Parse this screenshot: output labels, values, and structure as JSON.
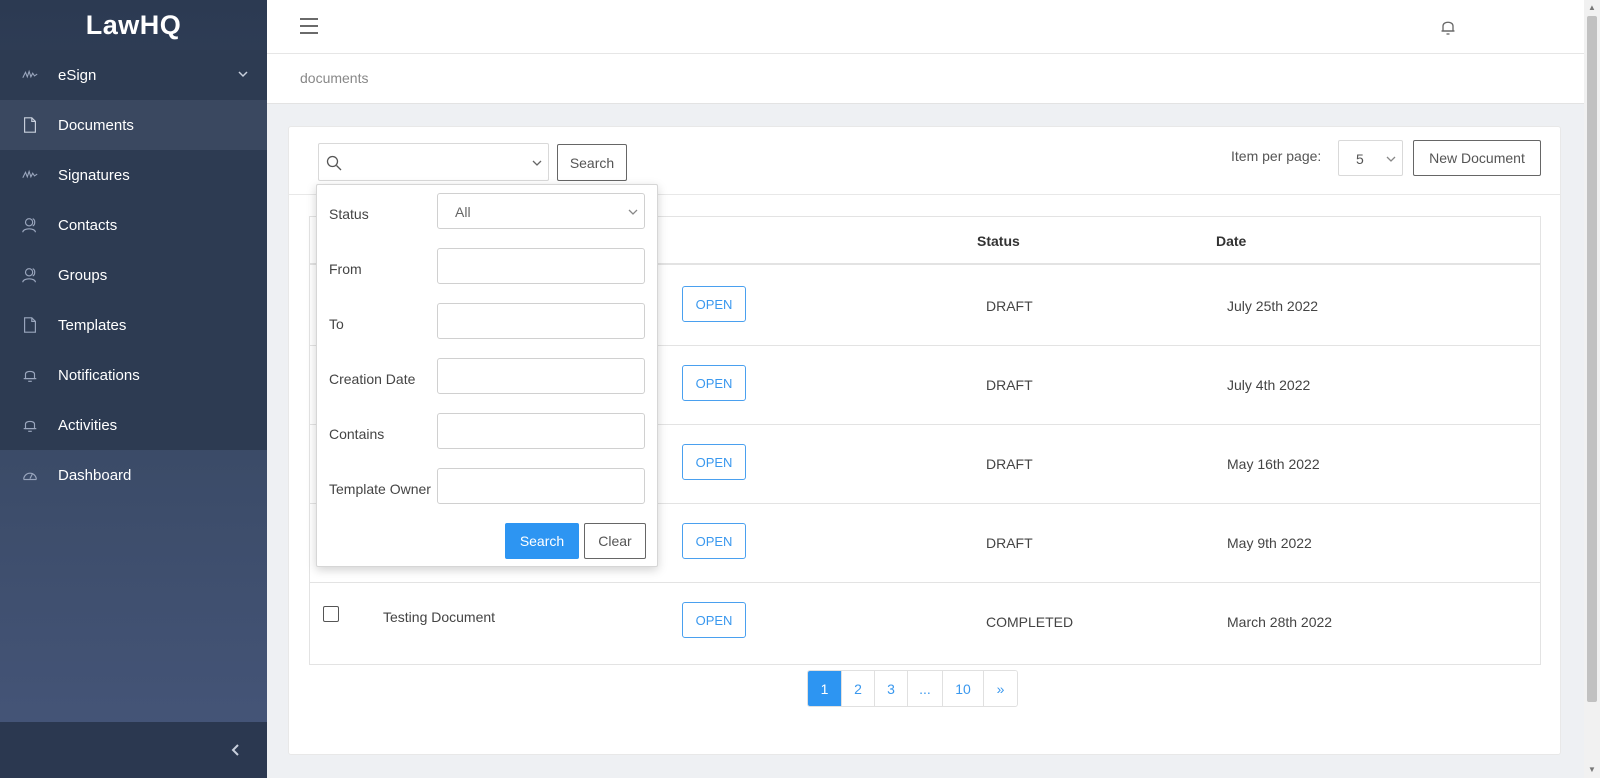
{
  "app": {
    "title": "LawHQ"
  },
  "sidebar": {
    "items": [
      {
        "label": "eSign",
        "icon": "signature-icon"
      },
      {
        "label": "Documents",
        "icon": "document-icon"
      },
      {
        "label": "Signatures",
        "icon": "signature-icon"
      },
      {
        "label": "Contacts",
        "icon": "contacts-icon"
      },
      {
        "label": "Groups",
        "icon": "groups-icon"
      },
      {
        "label": "Templates",
        "icon": "template-icon"
      },
      {
        "label": "Notifications",
        "icon": "bell-icon"
      },
      {
        "label": "Activities",
        "icon": "bell-icon"
      },
      {
        "label": "Dashboard",
        "icon": "dashboard-icon"
      }
    ]
  },
  "breadcrumb": "documents",
  "toolbar": {
    "search_value": "",
    "search_button": "Search",
    "per_page_label": "Item per page:",
    "per_page_value": "5",
    "new_document": "New Document"
  },
  "table": {
    "headers": {
      "status": "Status",
      "date": "Date"
    },
    "open_label": "OPEN",
    "rows": [
      {
        "name": "",
        "status": "DRAFT",
        "date": "July 25th 2022"
      },
      {
        "name": "",
        "status": "DRAFT",
        "date": "July 4th 2022"
      },
      {
        "name": "",
        "status": "DRAFT",
        "date": "May 16th 2022"
      },
      {
        "name": "",
        "status": "DRAFT",
        "date": "May 9th 2022"
      },
      {
        "name": "Testing Document",
        "status": "COMPLETED",
        "date": "March 28th 2022"
      }
    ]
  },
  "pagination": {
    "pages": [
      "1",
      "2",
      "3",
      "...",
      "10",
      "»"
    ],
    "active": "1"
  },
  "filter": {
    "status_label": "Status",
    "status_value": "All",
    "from_label": "From",
    "to_label": "To",
    "creation_date_label": "Creation Date",
    "contains_label": "Contains",
    "template_owner_label": "Template Owner",
    "search_button": "Search",
    "clear_button": "Clear"
  },
  "colors": {
    "accent": "#2d95f2",
    "sidebar": "#2c3a52",
    "open_button": "#3a98ee"
  }
}
